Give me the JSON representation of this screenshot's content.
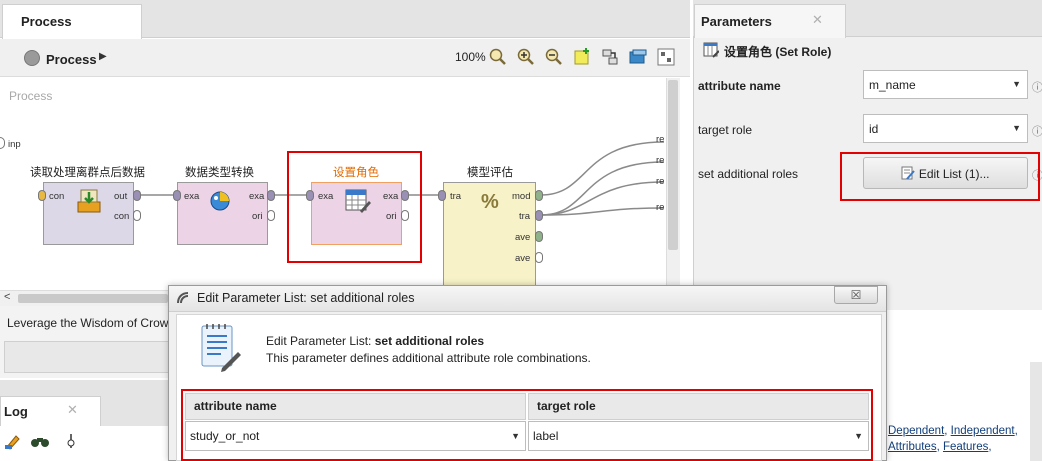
{
  "process_panel": {
    "tab_label": "Process",
    "breadcrumb": "Process",
    "zoom": "100%",
    "canvas_title": "Process",
    "input_port": "inp",
    "operators": [
      {
        "label": "读取处理离群点后数据",
        "ports_in": [
          "con"
        ],
        "ports_out": [
          "out",
          "con"
        ]
      },
      {
        "label": "数据类型转换",
        "ports_in": [
          "exa"
        ],
        "ports_out": [
          "exa",
          "ori"
        ]
      },
      {
        "label": "设置角色",
        "ports_in": [
          "exa"
        ],
        "ports_out": [
          "exa",
          "ori"
        ]
      },
      {
        "label": "模型评估",
        "ports_in": [
          "tra"
        ],
        "ports_out": [
          "mod",
          "tra",
          "ave",
          "ave"
        ]
      }
    ],
    "result_ports": [
      "re",
      "re",
      "re",
      "re"
    ]
  },
  "bottom_left": {
    "wisdom_text": "Leverage the Wisdom of Crow",
    "log_tab_label": "Log"
  },
  "parameters": {
    "tab_label": "Parameters",
    "operator_title": "设置角色 (Set Role)",
    "rows": [
      {
        "label": "attribute name",
        "value": "m_name"
      },
      {
        "label": "target role",
        "value": "id"
      }
    ],
    "additional_roles_label": "set additional roles",
    "edit_list_label": "Edit List (1)...",
    "help_links": [
      {
        "text": "Dependent",
        "suffix": ", "
      },
      {
        "text": "Independent",
        "suffix": ","
      },
      {
        "text": "Attributes",
        "suffix": ", "
      },
      {
        "text": "Features",
        "suffix": ","
      }
    ]
  },
  "dialog": {
    "title": "Edit Parameter List: set additional roles",
    "heading_prefix": "Edit Parameter List: ",
    "heading_bold": "set additional roles",
    "description": "This parameter defines additional attribute role combinations.",
    "close_symbol": "☒",
    "columns": [
      "attribute name",
      "target role"
    ],
    "rows": [
      {
        "attribute_name": "study_or_not",
        "target_role": "label"
      }
    ]
  },
  "colors": {
    "highlight": "#e30000",
    "selected_operator_label": "#e36b00",
    "link": "#123e7a"
  }
}
